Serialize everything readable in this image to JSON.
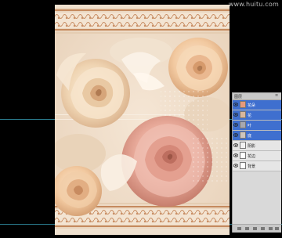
{
  "watermark": "www.huitu.com",
  "layers_panel": {
    "tab_label": "图层",
    "layers": [
      {
        "label": "花朵",
        "selected": true,
        "thumb_color": "#e79a7b"
      },
      {
        "label": "花",
        "selected": true,
        "thumb_color": "#d9b79c"
      },
      {
        "label": "叶",
        "selected": true,
        "thumb_color": "#a7a8b0"
      },
      {
        "label": "底",
        "selected": true,
        "thumb_color": "#cfc6bd"
      },
      {
        "label": "阴影",
        "selected": false,
        "thumb_color": "#f2f2f2"
      },
      {
        "label": "花边",
        "selected": false,
        "thumb_color": "#ffffff"
      },
      {
        "label": "背景",
        "selected": false,
        "thumb_color": "#ffffff"
      }
    ]
  }
}
